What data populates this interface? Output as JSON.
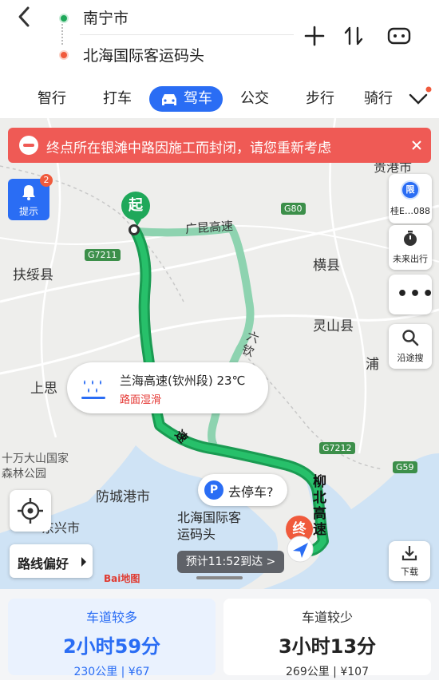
{
  "header": {
    "origin": "南宁市",
    "destination": "北海国际客运码头"
  },
  "tabs": [
    {
      "label": "智行"
    },
    {
      "label": "打车"
    },
    {
      "label": "驾车",
      "active": true
    },
    {
      "label": "公交"
    },
    {
      "label": "步行"
    },
    {
      "label": "骑行"
    }
  ],
  "alert": {
    "text": "终点所在银滩中路因施工而封闭，请您重新考虑"
  },
  "map": {
    "places": {
      "fusui": "扶绥县",
      "hengxian": "横县",
      "lingshan": "灵山县",
      "shangsi": "上思",
      "fangcheng": "防城港市",
      "shiwan_park": "十万大山国家森林公园",
      "pu": "浦",
      "guigang": "贵港市",
      "dongxing": "东兴市"
    },
    "road_labels": {
      "guangkun": "广昆高速",
      "liubei": "柳北高速",
      "liuqin": "六钦",
      "lanhai_part": "速"
    },
    "road_shields": [
      "G7211",
      "G80",
      "G7212",
      "G59"
    ],
    "start_badge": "起",
    "end_badge": "终",
    "destination_label": "北海国际客运码头",
    "weather": {
      "title": "兰海高速(钦州段) 23℃",
      "subtitle": "路面湿滑"
    },
    "parking": "去停车?",
    "eta": "预计11:52到达 >",
    "route_pref": "路线偏好",
    "brand": "Bai地图"
  },
  "side_buttons": {
    "tips_label": "提示",
    "tips_badge": "2",
    "restrict_label": "桂E…088",
    "future_label": "未来出行",
    "search_label": "沿途搜",
    "download_label": "下载"
  },
  "routes": [
    {
      "tag": "车道较多",
      "duration": "2小时59分",
      "meta": "230公里 | ¥67",
      "selected": true
    },
    {
      "tag": "车道较少",
      "duration": "3小时13分",
      "meta": "269公里 | ¥107",
      "selected": false
    }
  ],
  "colors": {
    "accent": "#2a6df4",
    "route_main": "#1fa85a",
    "route_alt": "#8ed3b0",
    "alert": "#ef5a55",
    "end_marker": "#f05a3c"
  }
}
